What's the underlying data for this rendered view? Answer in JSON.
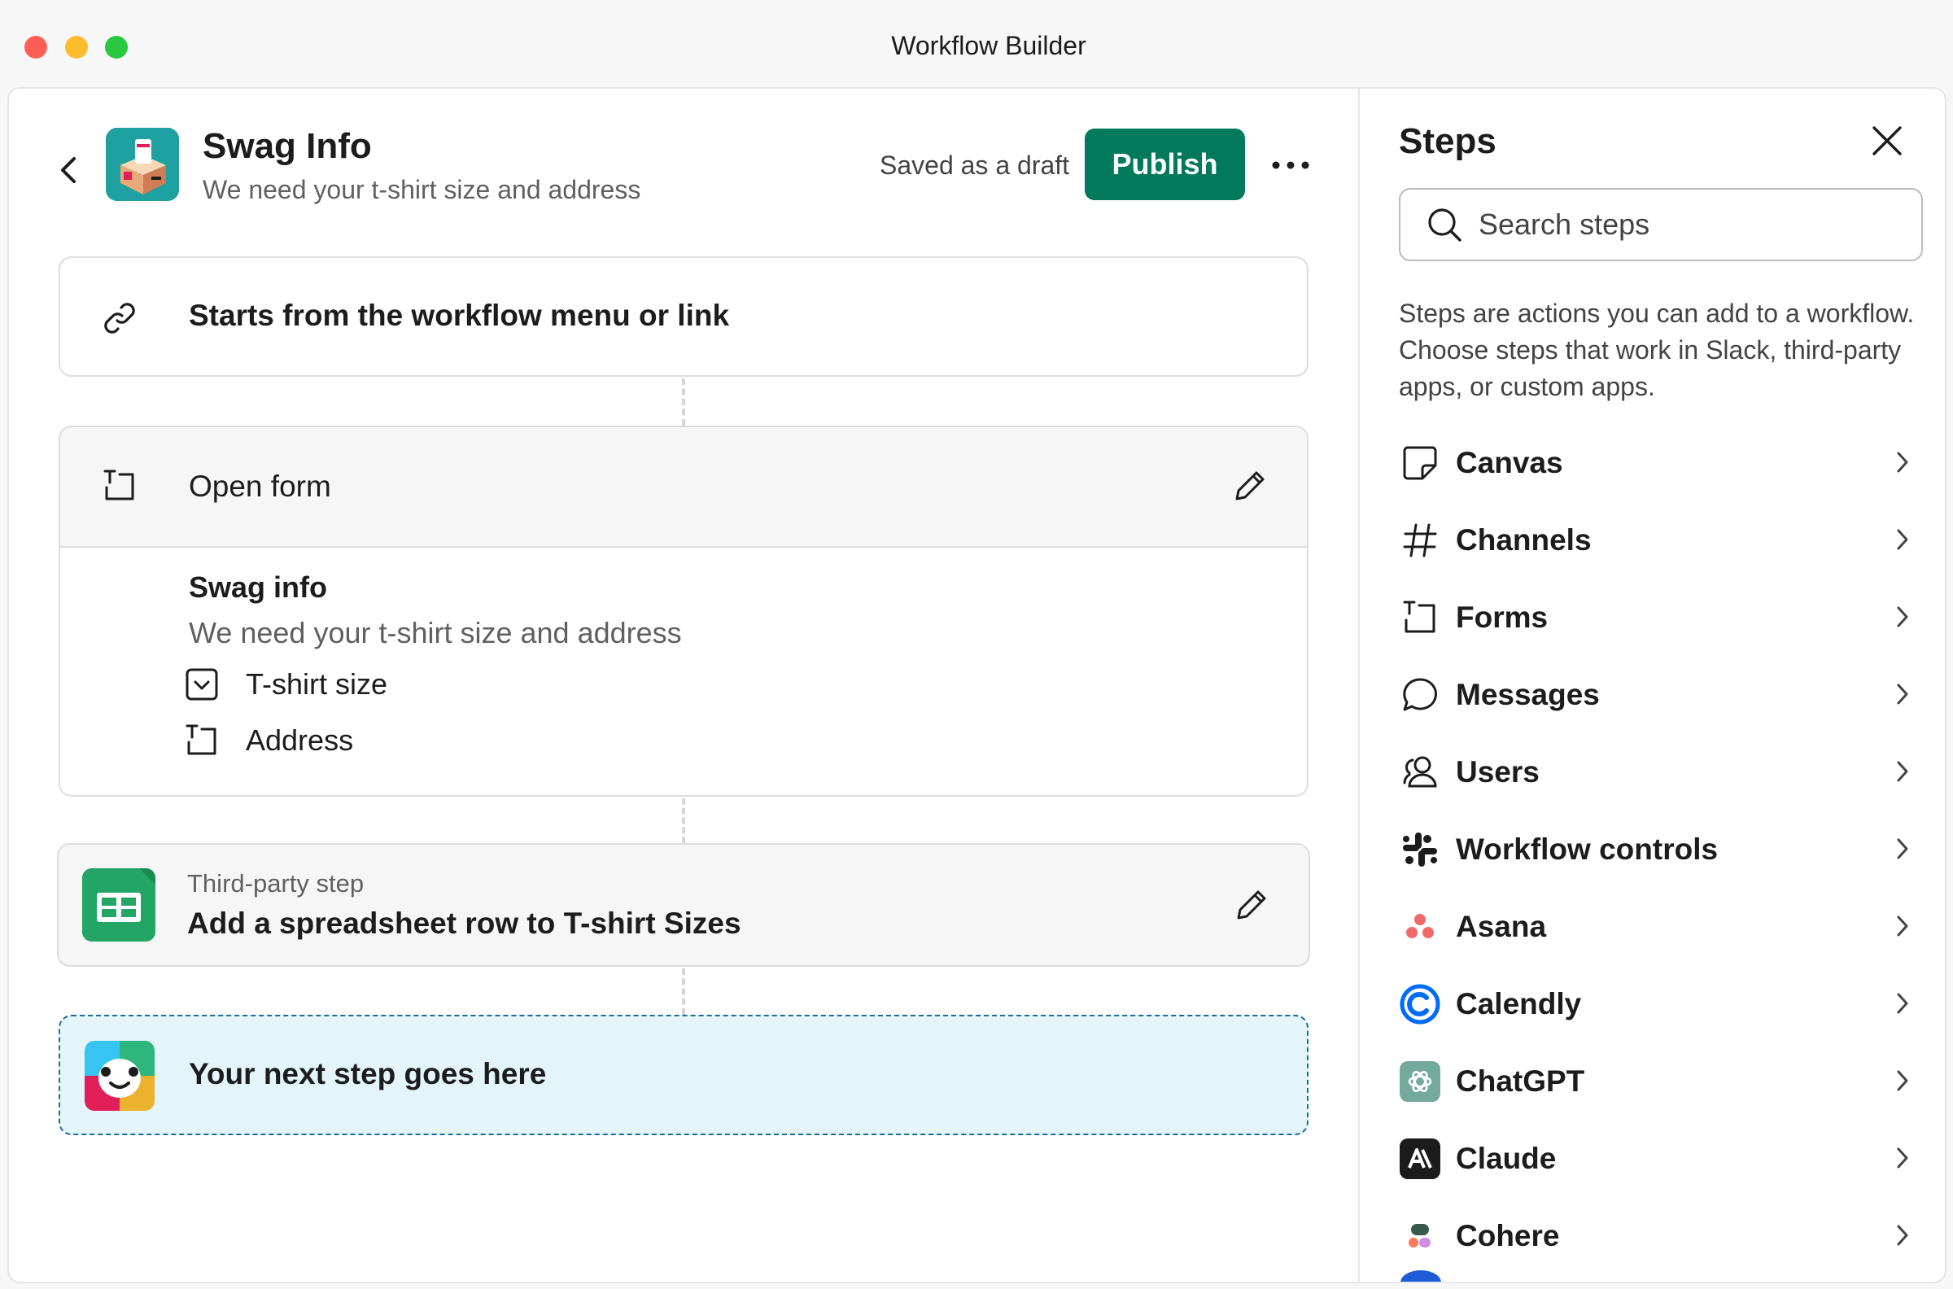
{
  "window": {
    "title": "Workflow Builder"
  },
  "workflow": {
    "title": "Swag Info",
    "subtitle": "We need your t-shirt size and address",
    "status": "Saved as a draft",
    "publish_label": "Publish"
  },
  "canvas": {
    "trigger": {
      "label": "Starts from the workflow menu or link"
    },
    "form_step": {
      "label": "Open form",
      "form_title": "Swag info",
      "form_description": "We need your t-shirt size and address",
      "fields": [
        {
          "label": "T-shirt size",
          "icon": "dropdown-field-icon"
        },
        {
          "label": "Address",
          "icon": "text-field-icon"
        }
      ]
    },
    "third_party_step": {
      "kind_label": "Third-party step",
      "label": "Add a spreadsheet row to T-shirt Sizes",
      "icon": "google-sheets-icon"
    },
    "next_step": {
      "label": "Your next step goes here"
    }
  },
  "sidebar": {
    "title": "Steps",
    "search": {
      "placeholder": "Search steps",
      "value": ""
    },
    "description": "Steps are actions you can add to a workflow. Choose steps that work in Slack, third-party apps, or custom apps.",
    "items": [
      {
        "label": "Canvas",
        "icon": "canvas-icon"
      },
      {
        "label": "Channels",
        "icon": "hash-icon"
      },
      {
        "label": "Forms",
        "icon": "form-icon"
      },
      {
        "label": "Messages",
        "icon": "message-icon"
      },
      {
        "label": "Users",
        "icon": "users-icon"
      },
      {
        "label": "Workflow controls",
        "icon": "slack-logo-icon"
      },
      {
        "label": "Asana",
        "icon": "asana-logo-icon"
      },
      {
        "label": "Calendly",
        "icon": "calendly-logo-icon"
      },
      {
        "label": "ChatGPT",
        "icon": "chatgpt-logo-icon"
      },
      {
        "label": "Claude",
        "icon": "claude-logo-icon"
      },
      {
        "label": "Cohere",
        "icon": "cohere-logo-icon"
      }
    ]
  },
  "colors": {
    "publish": "#007a5a",
    "next_step_bg": "#e3f4fb",
    "next_step_border": "#1d6b96"
  }
}
